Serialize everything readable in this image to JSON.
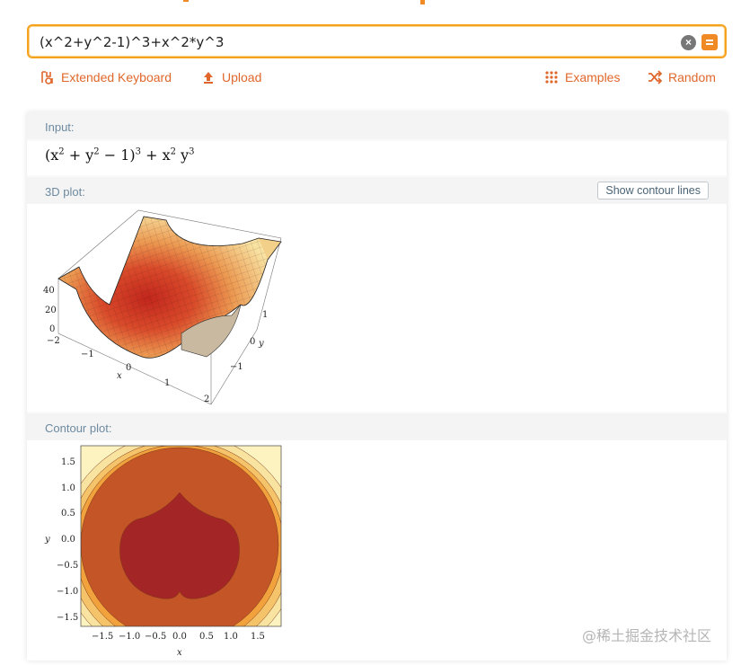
{
  "search": {
    "query": "(x^2+y^2-1)^3+x^2*y^3"
  },
  "toolbar": {
    "extended_keyboard": "Extended Keyboard",
    "upload": "Upload",
    "examples": "Examples",
    "random": "Random"
  },
  "pods": {
    "input": {
      "title": "Input:"
    },
    "plot3d": {
      "title": "3D plot:",
      "button": "Show contour lines",
      "z_ticks": [
        "40",
        "20",
        "0"
      ],
      "x_ticks": [
        "−2",
        "−1",
        "0",
        "1",
        "2"
      ],
      "y_ticks": [
        "1",
        "0",
        "−1"
      ],
      "xlabel": "x",
      "ylabel": "y"
    },
    "contour": {
      "title": "Contour plot:",
      "x_ticks": [
        "−1.5",
        "−1.0",
        "−0.5",
        "0.0",
        "0.5",
        "1.0",
        "1.5"
      ],
      "y_ticks": [
        "1.5",
        "1.0",
        "0.5",
        "0.0",
        "−0.5",
        "−1.0",
        "−1.5"
      ],
      "xlabel": "x",
      "ylabel": "y"
    }
  },
  "watermark": "@稀土掘金技术社区",
  "colors": {
    "accent": "#e0672c",
    "search_border": "#f5a21f",
    "pod_title": "#6d8aa0"
  }
}
